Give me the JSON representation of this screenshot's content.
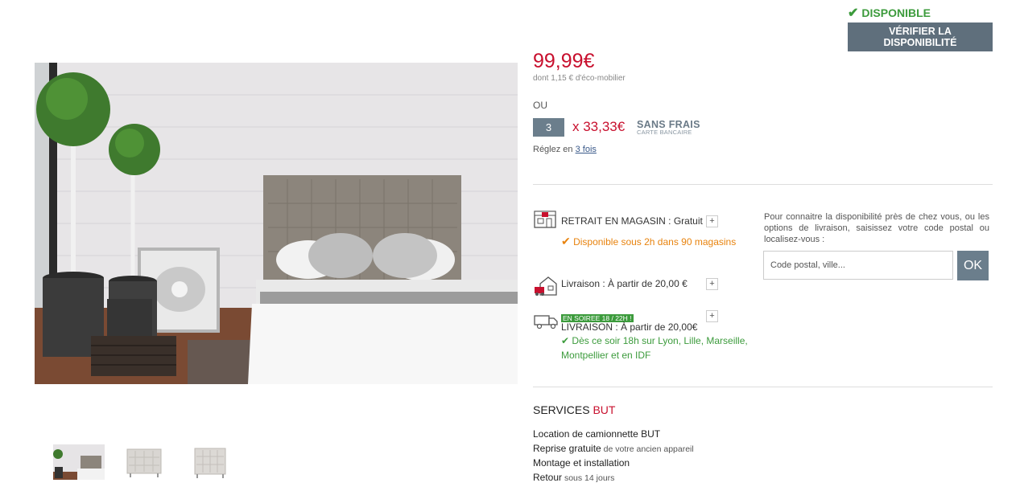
{
  "availability": {
    "status": "DISPONIBLE",
    "verify_button": "VÉRIFIER LA DISPONIBILITÉ"
  },
  "price": {
    "amount": "99,99€",
    "eco": "dont 1,15 € d'éco-mobilier",
    "ou": "OU",
    "installments_count": "3",
    "installment_amount": "x 33,33€",
    "sans_frais": "SANS FRAIS",
    "carte": "CARTE BANCAIRE",
    "reglez_prefix": "Réglez en ",
    "reglez_link": "3 fois"
  },
  "delivery": {
    "store": {
      "label": "RETRAIT EN MAGASIN",
      "sep": " : ",
      "price": "Gratuit",
      "note": "Disponible sous 2h dans 90 magasins"
    },
    "home": {
      "label": "Livraison",
      "sep": " : ",
      "price": "À partir de 20,00 €"
    },
    "evening": {
      "badge": "EN SOIREE 18 / 22H !",
      "label": "LIVRAISON",
      "sep": " : ",
      "price": "À partir de 20,00€",
      "note_line1": "Dès ce soir 18h sur Lyon, Lille, Marseille,",
      "note_line2": "Montpellier et en IDF"
    },
    "plus": "+"
  },
  "locator": {
    "info": "Pour connaitre la disponibilité près de chez vous, ou les options de livraison, saisissez votre code postal ou localisez-vous :",
    "placeholder": "Code postal, ville...",
    "ok": "OK"
  },
  "services": {
    "title": "SERVICES",
    "brand": "BUT",
    "items": [
      {
        "main": "Location de camionnette BUT",
        "sub": ""
      },
      {
        "main": "Reprise gratuite",
        "sub": " de votre ancien appareil"
      },
      {
        "main": "Montage et installation",
        "sub": ""
      },
      {
        "main": "Retour",
        "sub": " sous 14 jours"
      }
    ]
  },
  "colors": {
    "price_red": "#c8102e",
    "green": "#3c9b3c",
    "orange": "#e8830e",
    "slate": "#6b7e8c"
  }
}
